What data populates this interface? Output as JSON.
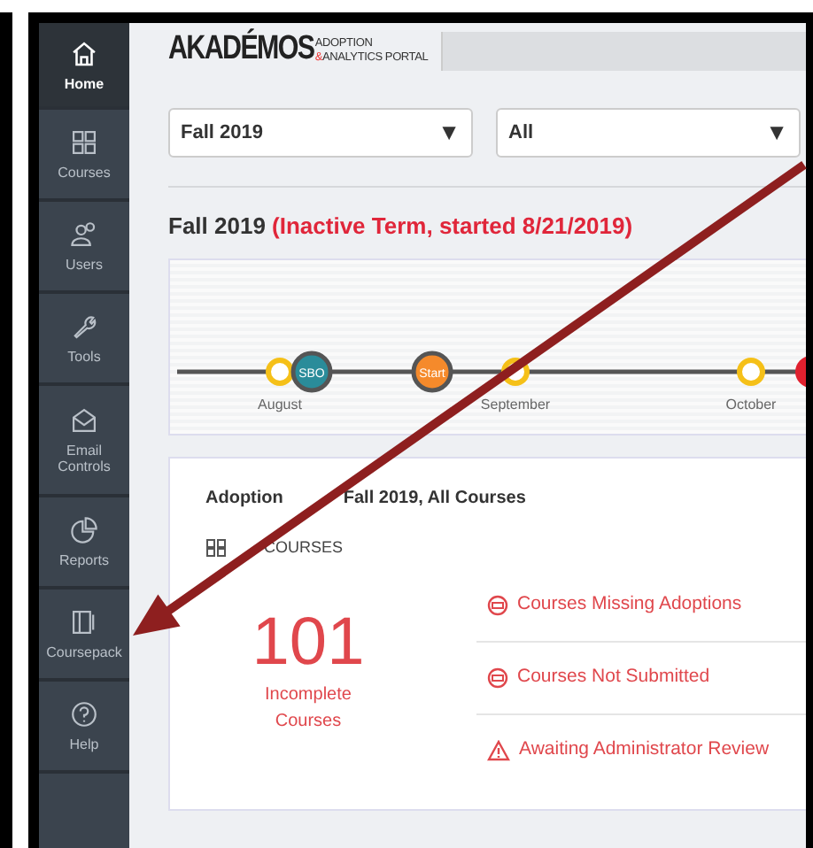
{
  "sidebar": {
    "items": [
      {
        "label": "Home",
        "selected": true
      },
      {
        "label": "Courses",
        "selected": false
      },
      {
        "label": "Users",
        "selected": false
      },
      {
        "label": "Tools",
        "selected": false
      },
      {
        "label": "Email Controls",
        "selected": false
      },
      {
        "label": "Reports",
        "selected": false
      },
      {
        "label": "Coursepack",
        "selected": false
      },
      {
        "label": "Help",
        "selected": false
      }
    ]
  },
  "header": {
    "logo": "AKADÉMOS",
    "logo_line_1": "ADOPTION",
    "logo_line_2_accent": "&",
    "logo_line_2": "ANALYTICS PORTAL"
  },
  "filters": [
    {
      "value": "Fall 2019",
      "caret": "▼"
    },
    {
      "value": "All",
      "caret": "▼"
    }
  ],
  "term": {
    "name": "Fall 2019",
    "status": "(Inactive Term, started 8/21/2019)"
  },
  "timeline": {
    "milestones": [
      {
        "kind": "deadline"
      },
      {
        "kind": "sbo",
        "label": "SBO"
      },
      {
        "kind": "start",
        "label": "Start"
      },
      {
        "kind": "deadline"
      },
      {
        "kind": "deadline"
      },
      {
        "kind": "alert"
      }
    ],
    "months": [
      "August",
      "September",
      "October"
    ]
  },
  "adoptions": {
    "title_start": "Adoption",
    "title_end": "Fall 2019, All Courses",
    "section": "COURSES",
    "count": "101",
    "count_label": "Incomplete Courses",
    "links": [
      {
        "kind": "blocked",
        "text": "Courses Missing Adoptions"
      },
      {
        "kind": "blocked",
        "text": "Courses Not Submitted"
      },
      {
        "kind": "warning",
        "text": "Awaiting Administrator Review"
      }
    ]
  }
}
